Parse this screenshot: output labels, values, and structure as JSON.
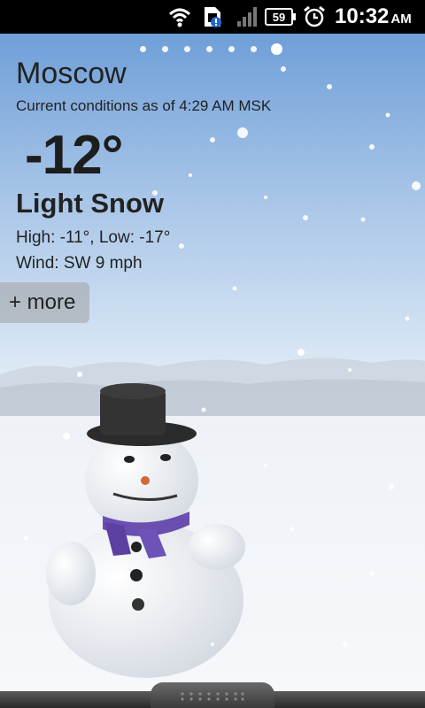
{
  "status_bar": {
    "battery_level": "59",
    "time": "10:32",
    "ampm": "AM"
  },
  "weather": {
    "city": "Moscow",
    "as_of": "Current conditions as of 4:29 AM MSK",
    "temperature": "-12°",
    "condition": "Light Snow",
    "high_low": "High: -11°, Low: -17°",
    "wind": "Wind: SW 9 mph",
    "more_label": "+ more"
  },
  "pager": {
    "count": 7,
    "active_index": 6
  },
  "colors": {
    "sky_top": "#6f9fd8",
    "sky_mid": "#cfe0f2",
    "snow": "#f4f6fa",
    "hat": "#2b2b2b",
    "scarf": "#6a4fb0"
  }
}
